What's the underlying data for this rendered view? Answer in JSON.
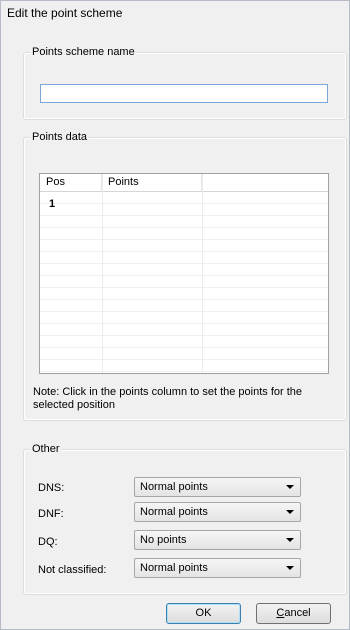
{
  "window": {
    "title": "Edit the point scheme"
  },
  "name_group": {
    "label": "Points scheme name",
    "input_value": "",
    "input_placeholder": ""
  },
  "data_group": {
    "label": "Points data",
    "columns": [
      "Pos",
      "Points",
      ""
    ],
    "rows": [
      {
        "pos": "1",
        "points": ""
      }
    ],
    "note": "Note: Click in the points column to set the points for the selected position"
  },
  "other_group": {
    "label": "Other",
    "fields": [
      {
        "label": "DNS:",
        "value": "Normal points"
      },
      {
        "label": "DNF:",
        "value": "Normal points"
      },
      {
        "label": "DQ:",
        "value": "No points"
      },
      {
        "label": "Not classified:",
        "value": "Normal points"
      }
    ]
  },
  "buttons": {
    "ok": "OK",
    "cancel_first": "C",
    "cancel_rest": "ancel"
  }
}
